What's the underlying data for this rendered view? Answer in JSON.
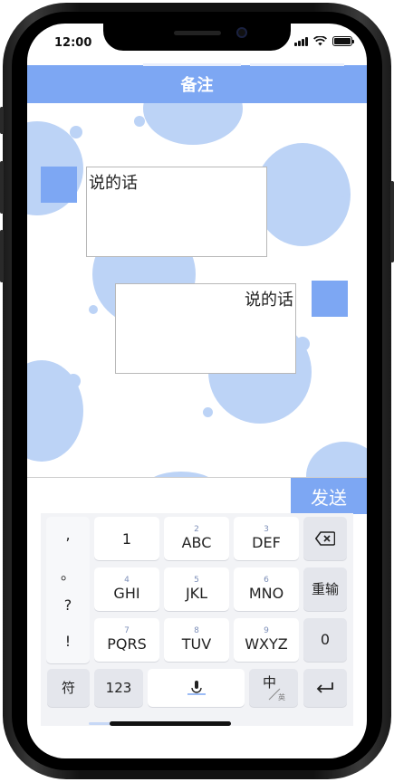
{
  "status_bar": {
    "time": "12:00"
  },
  "header": {
    "title": "备注"
  },
  "messages": [
    {
      "side": "left",
      "text": "说的话"
    },
    {
      "side": "right",
      "text": "说的话"
    }
  ],
  "composer": {
    "input_value": "",
    "send_label": "发送"
  },
  "keyboard": {
    "punctuation": [
      ",",
      "。",
      "?",
      "!"
    ],
    "rows": [
      [
        {
          "sup": "",
          "main": "1"
        },
        {
          "sup": "2",
          "main": "ABC"
        },
        {
          "sup": "3",
          "main": "DEF"
        }
      ],
      [
        {
          "sup": "4",
          "main": "GHI"
        },
        {
          "sup": "5",
          "main": "JKL"
        },
        {
          "sup": "6",
          "main": "MNO"
        }
      ],
      [
        {
          "sup": "7",
          "main": "PQRS"
        },
        {
          "sup": "8",
          "main": "TUV"
        },
        {
          "sup": "9",
          "main": "WXYZ"
        }
      ]
    ],
    "right_keys": {
      "delete_icon": "backspace-icon",
      "retype": "重输",
      "zero": "0"
    },
    "bottom": {
      "symbols": "符",
      "numbers": "123",
      "mic_icon": "microphone-icon",
      "lang_main": "中",
      "lang_sub": "英",
      "enter_icon": "return-icon"
    }
  },
  "colors": {
    "accent": "#7da7f3",
    "bubble": "#bcd3f6"
  }
}
